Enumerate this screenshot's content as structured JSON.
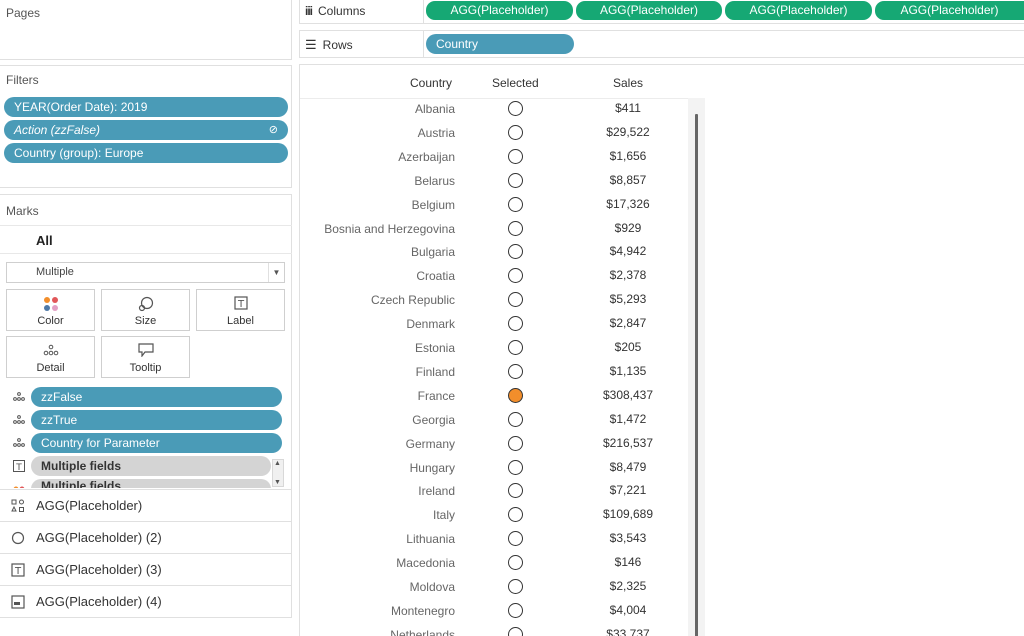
{
  "pages": {
    "title": "Pages"
  },
  "shelves": {
    "columns_label": "Columns",
    "rows_label": "Rows",
    "columns_pills": [
      "AGG(Placeholder)",
      "AGG(Placeholder)",
      "AGG(Placeholder)",
      "AGG(Placeholder)"
    ],
    "rows_pills": [
      "Country"
    ]
  },
  "filters": {
    "title": "Filters",
    "items": [
      "YEAR(Order Date): 2019",
      "Action (zzFalse)",
      "Country (group): Europe"
    ]
  },
  "marks": {
    "title": "Marks",
    "all_label": "All",
    "mark_type": "Multiple",
    "buttons": {
      "color": "Color",
      "size": "Size",
      "label": "Label",
      "detail": "Detail",
      "tooltip": "Tooltip"
    },
    "fields": [
      "zzFalse",
      "zzTrue",
      "Country for Parameter",
      "Multiple fields",
      "Multiple fields"
    ],
    "sections": [
      "AGG(Placeholder)",
      "AGG(Placeholder) (2)",
      "AGG(Placeholder) (3)",
      "AGG(Placeholder) (4)"
    ]
  },
  "colors": {
    "pill_blue": "#4a9bb7",
    "pill_green": "#16a874",
    "selected": "#f28e2b"
  },
  "table": {
    "headers": {
      "country": "Country",
      "selected": "Selected",
      "sales": "Sales"
    },
    "rows": [
      {
        "country": "Albania",
        "selected": false,
        "sales": "$411"
      },
      {
        "country": "Austria",
        "selected": false,
        "sales": "$29,522"
      },
      {
        "country": "Azerbaijan",
        "selected": false,
        "sales": "$1,656"
      },
      {
        "country": "Belarus",
        "selected": false,
        "sales": "$8,857"
      },
      {
        "country": "Belgium",
        "selected": false,
        "sales": "$17,326"
      },
      {
        "country": "Bosnia and Herzegovina",
        "selected": false,
        "sales": "$929"
      },
      {
        "country": "Bulgaria",
        "selected": false,
        "sales": "$4,942"
      },
      {
        "country": "Croatia",
        "selected": false,
        "sales": "$2,378"
      },
      {
        "country": "Czech Republic",
        "selected": false,
        "sales": "$5,293"
      },
      {
        "country": "Denmark",
        "selected": false,
        "sales": "$2,847"
      },
      {
        "country": "Estonia",
        "selected": false,
        "sales": "$205"
      },
      {
        "country": "Finland",
        "selected": false,
        "sales": "$1,135"
      },
      {
        "country": "France",
        "selected": true,
        "sales": "$308,437"
      },
      {
        "country": "Georgia",
        "selected": false,
        "sales": "$1,472"
      },
      {
        "country": "Germany",
        "selected": false,
        "sales": "$216,537"
      },
      {
        "country": "Hungary",
        "selected": false,
        "sales": "$8,479"
      },
      {
        "country": "Ireland",
        "selected": false,
        "sales": "$7,221"
      },
      {
        "country": "Italy",
        "selected": false,
        "sales": "$109,689"
      },
      {
        "country": "Lithuania",
        "selected": false,
        "sales": "$3,543"
      },
      {
        "country": "Macedonia",
        "selected": false,
        "sales": "$146"
      },
      {
        "country": "Moldova",
        "selected": false,
        "sales": "$2,325"
      },
      {
        "country": "Montenegro",
        "selected": false,
        "sales": "$4,004"
      },
      {
        "country": "Netherlands",
        "selected": false,
        "sales": "$33,737"
      }
    ]
  }
}
